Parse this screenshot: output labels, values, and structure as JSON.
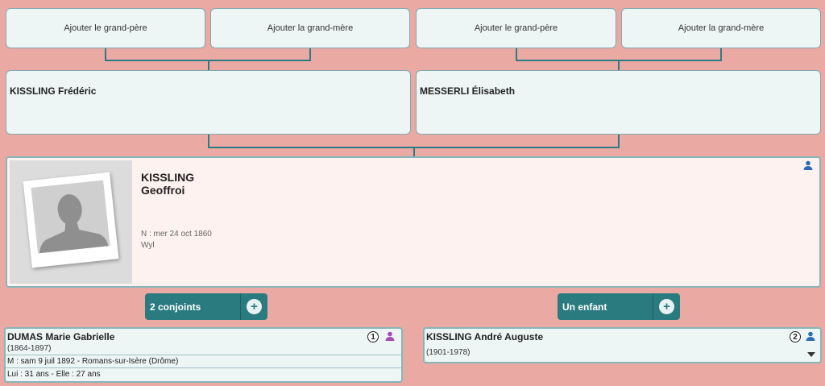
{
  "grandparents": {
    "paternal_grandfather": "Ajouter le grand-père",
    "paternal_grandmother": "Ajouter la grand-mère",
    "maternal_grandfather": "Ajouter le grand-père",
    "maternal_grandmother": "Ajouter la grand-mère"
  },
  "parents": {
    "father": "KISSLING Frédéric",
    "mother": "MESSERLI Élisabeth"
  },
  "person": {
    "last_name": "KISSLING",
    "first_name": "Geoffroi",
    "birth": "N : mer 24 oct 1860",
    "birth_place": "Wyl"
  },
  "buttons": {
    "spouses": "2 conjoints",
    "children": "Un enfant",
    "add": "+"
  },
  "spouse": {
    "name": "DUMAS Marie Gabrielle",
    "dates": "(1864-1897)",
    "badge": "1",
    "marriage": "M : sam 9 juil 1892 - Romans-sur-Isère (Drôme)",
    "ages": "Lui : 31 ans - Elle : 27 ans"
  },
  "child": {
    "name": "KISSLING André Auguste",
    "dates": "(1901-1978)",
    "badge": "2"
  },
  "colors": {
    "background": "#eba9a4",
    "accent": "#2a7b80",
    "male_icon": "#2d6db5",
    "female_icon": "#a64bb5"
  },
  "icons": {
    "male": "person-icon",
    "female": "person-icon",
    "expand": "caret-down-icon"
  }
}
